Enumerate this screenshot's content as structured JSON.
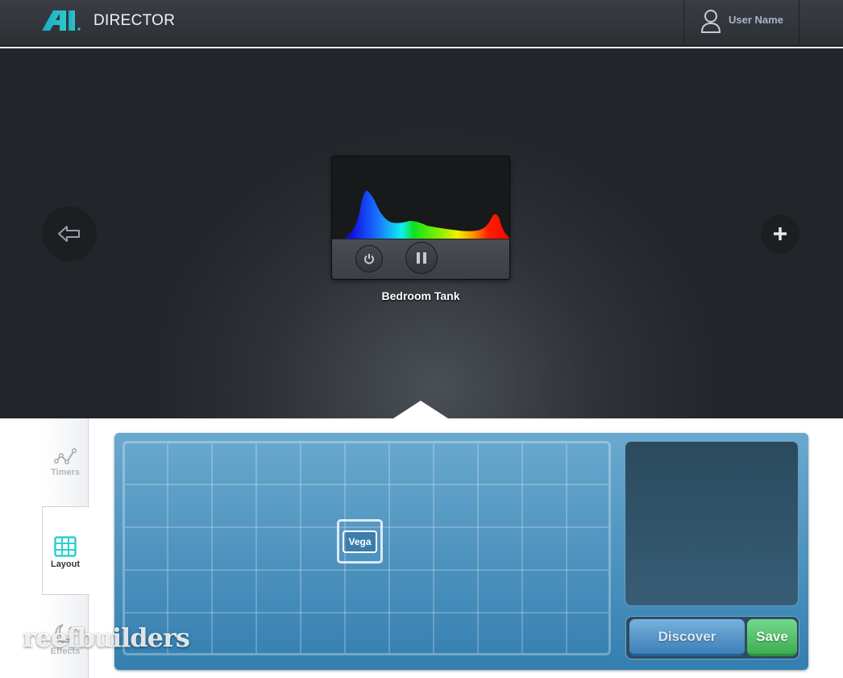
{
  "header": {
    "app_title": "DIRECTOR",
    "logo_text": "AI",
    "user_name": "User Name",
    "logo_color": "#27b8c8"
  },
  "stage": {
    "back_icon": "arrow-left-icon",
    "add_icon": "plus-icon",
    "device": {
      "name": "Bedroom Tank",
      "power_icon": "power-icon",
      "pause_icon": "pause-icon"
    }
  },
  "sidebar": {
    "items": [
      {
        "label": "Timers",
        "icon": "line-graph-icon",
        "active": false
      },
      {
        "label": "Layout",
        "icon": "grid-icon",
        "active": true
      },
      {
        "label": "Effects",
        "icon": "moon-stars-icon",
        "active": false
      }
    ]
  },
  "layout": {
    "grid_columns": 11,
    "grid_rows": 5,
    "tiles": [
      {
        "label": "Vega",
        "column": 6,
        "row": 3
      }
    ]
  },
  "actions": {
    "discover_label": "Discover",
    "save_label": "Save"
  },
  "watermark": "reefbuilders",
  "colors": {
    "accent": "#2ecfcf",
    "save": "#4cbb5e",
    "panel": "#4a90c0"
  }
}
